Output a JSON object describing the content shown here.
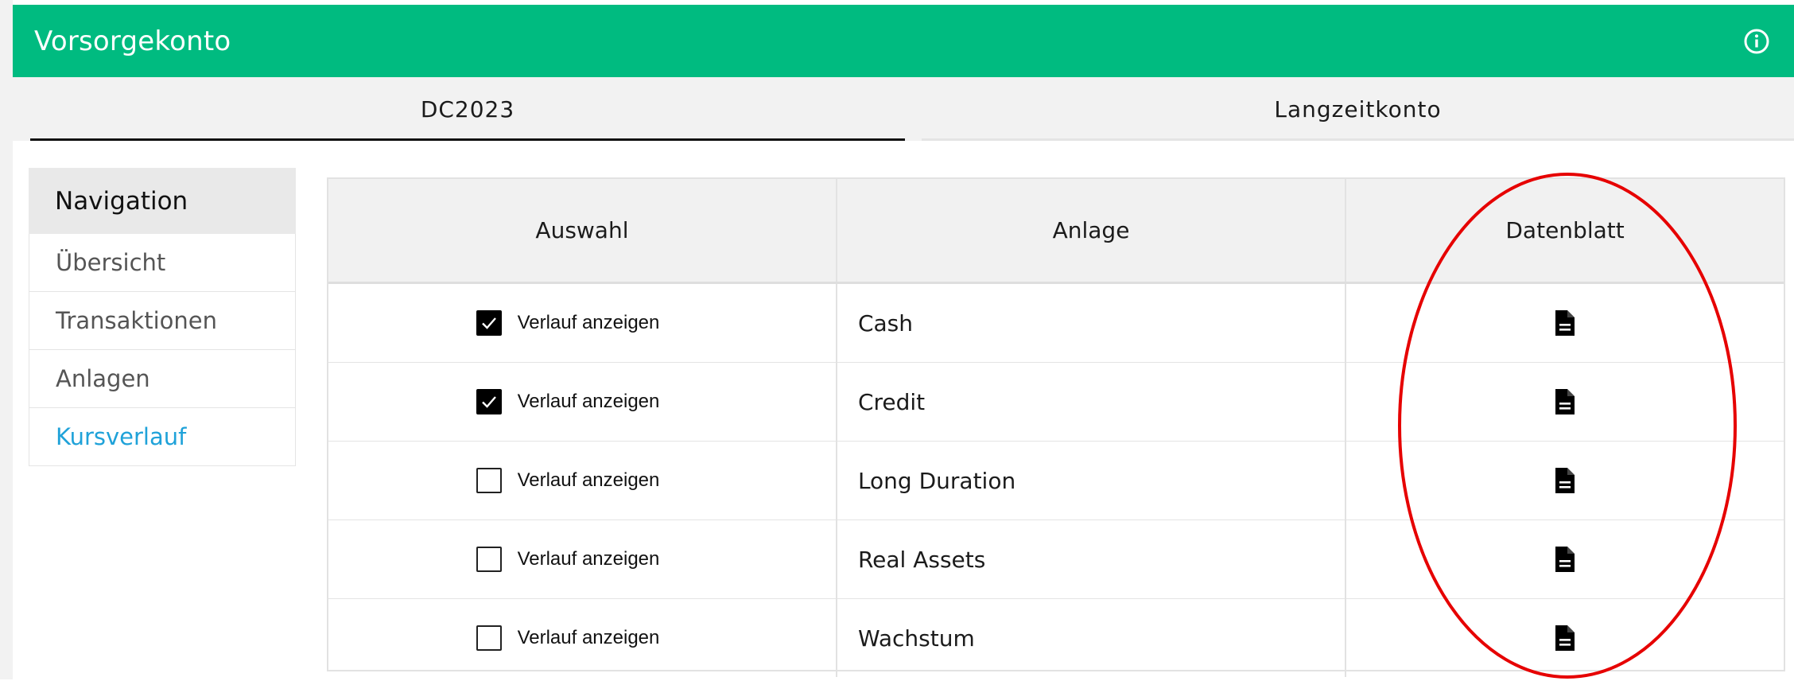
{
  "header": {
    "title": "Vorsorgekonto",
    "info_icon": "info-circle-icon",
    "background_color": "#00bb80"
  },
  "tabs": [
    {
      "label": "DC2023",
      "active": true
    },
    {
      "label": "Langzeitkonto",
      "active": false
    }
  ],
  "navigation": {
    "title": "Navigation",
    "items": [
      {
        "label": "Übersicht",
        "active": false
      },
      {
        "label": "Transaktionen",
        "active": false
      },
      {
        "label": "Anlagen",
        "active": false
      },
      {
        "label": "Kursverlauf",
        "active": true
      }
    ],
    "active_color": "#1fa2d9"
  },
  "table": {
    "columns": [
      "Auswahl",
      "Anlage",
      "Datenblatt"
    ],
    "rows": [
      {
        "checked": true,
        "select_label": "Verlauf anzeigen",
        "anlage": "Cash",
        "datasheet_icon": "document-icon"
      },
      {
        "checked": true,
        "select_label": "Verlauf anzeigen",
        "anlage": "Credit",
        "datasheet_icon": "document-icon"
      },
      {
        "checked": false,
        "select_label": "Verlauf anzeigen",
        "anlage": "Long Duration",
        "datasheet_icon": "document-icon"
      },
      {
        "checked": false,
        "select_label": "Verlauf anzeigen",
        "anlage": "Real Assets",
        "datasheet_icon": "document-icon"
      },
      {
        "checked": false,
        "select_label": "Verlauf anzeigen",
        "anlage": "Wachstum",
        "datasheet_icon": "document-icon"
      }
    ]
  },
  "annotation": {
    "shape": "ellipse",
    "color": "#e60000",
    "target": "Datenblatt column"
  }
}
